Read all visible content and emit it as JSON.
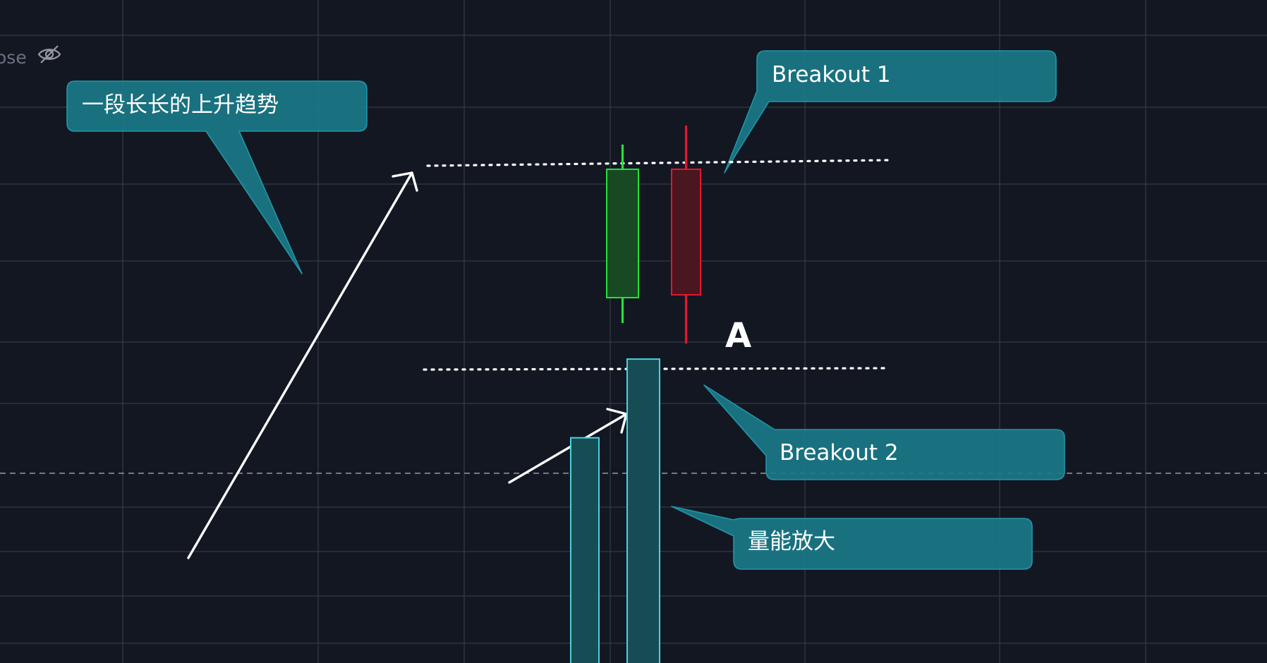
{
  "legend": {
    "partial_label": "ose",
    "visibility_icon": "eye-off-icon"
  },
  "annotations": {
    "uptrend_callout": "一段长长的上升趋势",
    "breakout1_callout": "Breakout 1",
    "breakout2_callout": "Breakout 2",
    "volume_callout": "量能放大",
    "point_label": "A"
  },
  "colors": {
    "background": "#131722",
    "grid": "#363a45",
    "bull": "#26e03a",
    "bull_body": "#174a22",
    "bear": "#e5162d",
    "bear_body": "#4a1620",
    "volume_border": "#4dd0e1",
    "volume_fill": "#164d55",
    "callout_fill": "#1a7a88",
    "callout_border": "#2196a8",
    "level_line": "#ffffff",
    "arrow": "#ffffff",
    "price_line": "#9598a1"
  },
  "chart_data": {
    "type": "candlestick",
    "candles": [
      {
        "direction": "up",
        "open": 422,
        "close": 240,
        "high": 205,
        "low": 458
      },
      {
        "direction": "down",
        "open": 240,
        "close": 418,
        "high": 178,
        "low": 487
      }
    ],
    "volume_bars": [
      {
        "value": 206
      },
      {
        "value": 278
      }
    ],
    "levels": [
      {
        "name": "Breakout 1",
        "price": 201
      },
      {
        "name": "Breakout 2",
        "price": 456
      }
    ]
  }
}
